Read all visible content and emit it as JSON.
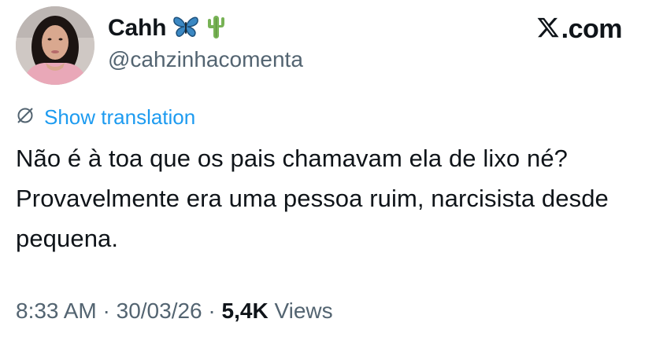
{
  "author": {
    "display_name": "Cahh",
    "handle": "@cahzinhacomenta",
    "badges": [
      "butterfly-icon",
      "cactus-icon"
    ]
  },
  "brand": {
    "label": ".com",
    "icon": "x-logo-icon"
  },
  "translation": {
    "icon": "globe-icon",
    "label": "Show translation"
  },
  "tweet": {
    "text": "Não é à toa que os pais chamavam ela de lixo né? Provavelmente era uma pessoa ruim, narcisista desde pequena."
  },
  "meta": {
    "time": "8:33 AM",
    "separator": " · ",
    "date": "30/03/26",
    "views_count": "5,4K",
    "views_label": " Views"
  },
  "colors": {
    "link": "#1d9bf0",
    "secondary": "#536471",
    "primary": "#0f1419"
  }
}
